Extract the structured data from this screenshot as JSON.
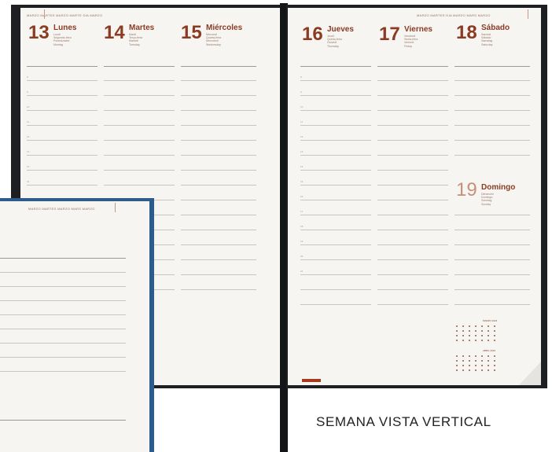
{
  "planner": {
    "header_left": "MARZO  MARTES  MARZO  MARTE·DIA  MARZO",
    "header_right": "MARZO  MARTES·DIA  MARZO  MARS  MARZO",
    "small_header": "MARZO  MARTES  MARZO  MARS  MARZO",
    "days": [
      {
        "num": "13",
        "name": "Lunes",
        "subs": [
          "Lundi",
          "Segunda-feira",
          "Poniedziałek",
          "Montag"
        ]
      },
      {
        "num": "14",
        "name": "Martes",
        "subs": [
          "Mardi",
          "Terça-feira",
          "Martedì",
          "Tuesday"
        ]
      },
      {
        "num": "15",
        "name": "Miércoles",
        "subs": [
          "Mercredi",
          "Quarta-feira",
          "Mercoledì",
          "Wednesday"
        ]
      },
      {
        "num": "16",
        "name": "Jueves",
        "subs": [
          "Jeudi",
          "Quinta-feira",
          "Giovedì",
          "Thursday"
        ]
      },
      {
        "num": "17",
        "name": "Viernes",
        "subs": [
          "Vendredi",
          "Sexta-feira",
          "Venerdì",
          "Friday"
        ]
      },
      {
        "num": "18",
        "name": "Sábado",
        "subs": [
          "Samedi",
          "Sábado",
          "Samstag",
          "Saturday"
        ]
      },
      {
        "num": "19",
        "name": "Domingo",
        "subs": [
          "Dimanche",
          "Domingo",
          "Sonntag",
          "Sunday"
        ]
      }
    ],
    "hours": [
      "8",
      "9",
      "10",
      "11",
      "12",
      "13",
      "14",
      "15",
      "16",
      "17",
      "18",
      "19",
      "20",
      "21"
    ],
    "mini_cal_1": "MARZO  2023",
    "mini_cal_2": "ABRIL  2023"
  },
  "caption": "SEMANA VISTA VERTICAL",
  "colors": {
    "accent": "#8a3b22",
    "cover": "#1d1f22",
    "blue_cover": "#2d5b8c"
  }
}
